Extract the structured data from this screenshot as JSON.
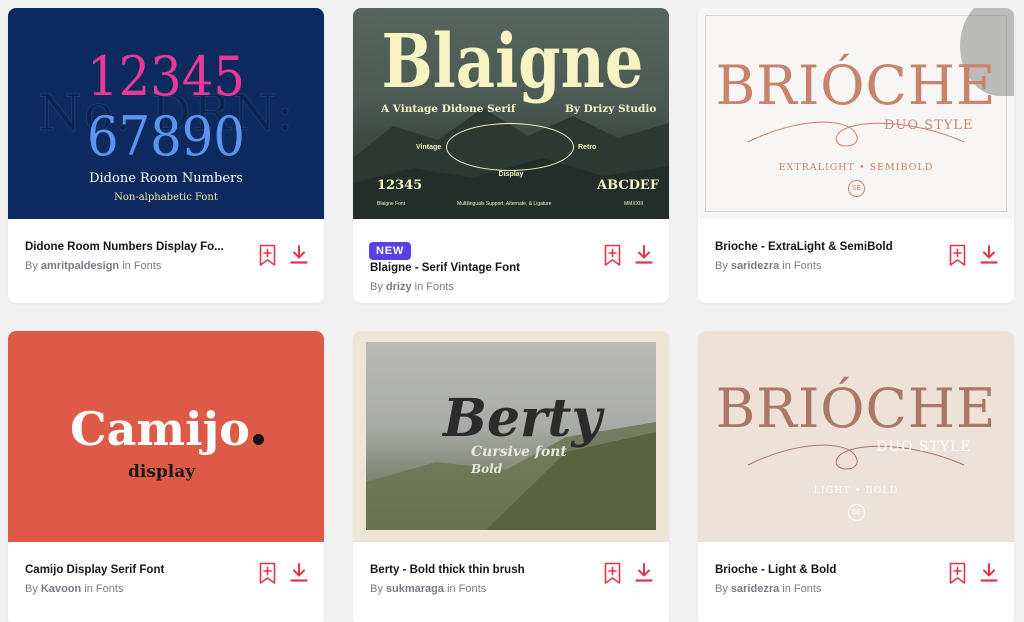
{
  "cards": [
    {
      "title": "Didone Room Numbers Display Fo...",
      "author_prefix": "By ",
      "author": "amritpaldesign",
      "category": "in Fonts",
      "new": false,
      "art": {
        "line1": "12345",
        "line2": "67890",
        "name": "Didone Room Numbers",
        "sub": "Non-alphabetic Font",
        "bg_text": "No. DRN:"
      }
    },
    {
      "title": "Blaigne - Serif Vintage Font",
      "author_prefix": "By ",
      "author": "drizy",
      "category": "in Fonts",
      "new": true,
      "badge": "NEW",
      "art": {
        "name": "Blaigne",
        "tag": "A Vintage Didone Serif",
        "studio": "By Drizy Studio",
        "left": "Vintage",
        "right": "Retro",
        "display": "Display",
        "nums": "12345",
        "letters": "ABCDEF",
        "footer_left": "Blaigne Font",
        "footer_mid": "Multilinguals Support, Alternate, & Ligature",
        "footer_right": "MMXXIII"
      }
    },
    {
      "title": "Brioche - ExtraLight & SemiBold",
      "author_prefix": "By ",
      "author": "saridezra",
      "category": "in Fonts",
      "new": false,
      "art": {
        "name": "BRIÓCHE",
        "style": "DUO STYLE",
        "weights": "EXTRALIGHT • SEMIBOLD",
        "mono": "SE"
      }
    },
    {
      "title": "Camijo Display Serif Font",
      "author_prefix": "By ",
      "author": "Kavoon",
      "category": "in Fonts",
      "new": false,
      "art": {
        "name": "Camijo",
        "sub": "display"
      }
    },
    {
      "title": "Berty - Bold thick thin brush",
      "author_prefix": "By ",
      "author": "sukmaraga",
      "category": "in Fonts",
      "new": false,
      "art": {
        "name": "Berty",
        "line1": "Cursive font",
        "line2": "Bold"
      }
    },
    {
      "title": "Brioche - Light & Bold",
      "author_prefix": "By ",
      "author": "saridezra",
      "category": "in Fonts",
      "new": false,
      "art": {
        "name": "BRIÓCHE",
        "style": "DUO STYLE",
        "weights": "LIGHT • BOLD",
        "mono": "SE"
      }
    }
  ],
  "icons": {
    "bookmark": "bookmark-add-icon",
    "download": "download-icon"
  },
  "colors": {
    "accent": "#e0364d",
    "badge": "#5a3fe6"
  }
}
